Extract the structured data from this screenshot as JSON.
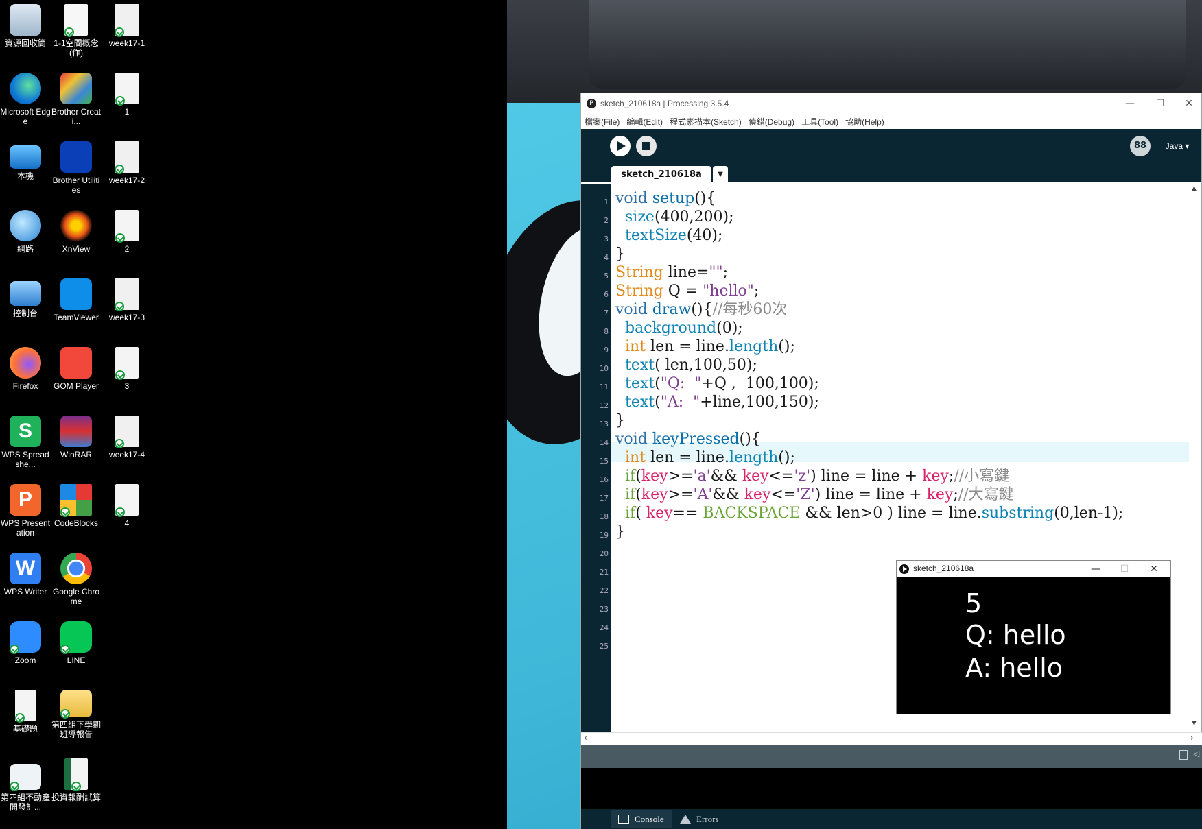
{
  "desktop": {
    "icons": [
      {
        "label": "資源回收筒"
      },
      {
        "label": "1-1空間概念(作)"
      },
      {
        "label": "week17-1"
      },
      {
        "label": "Microsoft Edge"
      },
      {
        "label": "Brother Creati..."
      },
      {
        "label": "1"
      },
      {
        "label": "本機"
      },
      {
        "label": "Brother Utilities"
      },
      {
        "label": "week17-2"
      },
      {
        "label": "網路"
      },
      {
        "label": "XnView"
      },
      {
        "label": "2"
      },
      {
        "label": "控制台"
      },
      {
        "label": "TeamViewer"
      },
      {
        "label": "week17-3"
      },
      {
        "label": "Firefox"
      },
      {
        "label": "GOM Player"
      },
      {
        "label": "3"
      },
      {
        "label": "WPS Spreadshe..."
      },
      {
        "label": "WinRAR"
      },
      {
        "label": "week17-4"
      },
      {
        "label": "WPS Presentation"
      },
      {
        "label": "CodeBlocks"
      },
      {
        "label": "4"
      },
      {
        "label": "WPS Writer"
      },
      {
        "label": "Google Chrome"
      },
      {
        "label": "Zoom"
      },
      {
        "label": "LINE"
      },
      {
        "label": "基礎題"
      },
      {
        "label": "第四組下學期班導報告"
      },
      {
        "label": "第四組不動產開發計..."
      },
      {
        "label": "投資報酬試算"
      }
    ]
  },
  "processing": {
    "window_title": "sketch_210618a | Processing 3.5.4",
    "menu": [
      "檔案(File)",
      "編輯(Edit)",
      "程式素描本(Sketch)",
      "偵錯(Debug)",
      "工具(Tool)",
      "協助(Help)"
    ],
    "mode": "Java ▾",
    "mode_icon": "88",
    "tab_name": "sketch_210618a",
    "line_numbers": [
      "1",
      "2",
      "3",
      "4",
      "5",
      "6",
      "7",
      "8",
      "9",
      "10",
      "11",
      "12",
      "13",
      "14",
      "15",
      "16",
      "17",
      "18",
      "19",
      "20",
      "21",
      "22",
      "23",
      "24",
      "25"
    ],
    "code": {
      "l1": [
        "void",
        " ",
        "setup",
        "(){"
      ],
      "l2": [
        "  ",
        "size",
        "(400,200);"
      ],
      "l3": [
        "  ",
        "textSize",
        "(40);"
      ],
      "l4": [
        "}"
      ],
      "l5": [
        "String",
        " line=",
        "\"\"",
        ";"
      ],
      "l6": [
        "String",
        " Q = ",
        "\"hello\"",
        ";"
      ],
      "l7": [
        "void",
        " ",
        "draw",
        "(){",
        "//每秒60次"
      ],
      "l8": [
        "  ",
        "background",
        "(0);"
      ],
      "l9": [
        "  ",
        "int",
        " len = line.",
        "length",
        "();"
      ],
      "l10": [
        "  ",
        "text",
        "( len,100,50);"
      ],
      "l11": [
        "  ",
        "text",
        "(",
        "\"Q:  \"",
        "+Q ,  100,100);"
      ],
      "l12": [
        "  ",
        "text",
        "(",
        "\"A:  \"",
        "+line,100,150);"
      ],
      "l13": [
        "}"
      ],
      "l14": [
        "void",
        " ",
        "keyPressed",
        "(){"
      ],
      "l15": [
        "  ",
        "int",
        " len = line.",
        "length",
        "();"
      ],
      "l16": [
        "  ",
        "if",
        "(",
        "key",
        ">=",
        "'a'",
        "&& ",
        "key",
        "<=",
        "'z'",
        ") line = line + ",
        "key",
        ";",
        "//小寫鍵"
      ],
      "l17": [
        "  ",
        "if",
        "(",
        "key",
        ">=",
        "'A'",
        "&& ",
        "key",
        "<=",
        "'Z'",
        ") line = line + ",
        "key",
        ";",
        "//大寫鍵"
      ],
      "l18": [
        "  ",
        "if",
        "( ",
        "key",
        "== ",
        "BACKSPACE",
        " && len>0 ) line = line.",
        "substring",
        "(0,len-1);"
      ],
      "l19": [
        "}"
      ]
    },
    "footer_tabs": {
      "console": "Console",
      "errors": "Errors"
    }
  },
  "sketch_window": {
    "title": "sketch_210618a",
    "line1": "5",
    "line2": "Q:  hello",
    "line3": "A:  hello"
  }
}
